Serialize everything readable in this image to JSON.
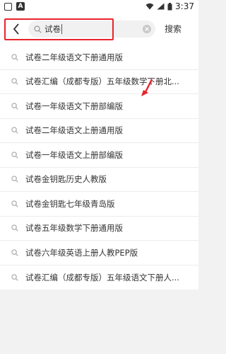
{
  "status_bar": {
    "time": "3:37"
  },
  "search": {
    "query": "试卷",
    "button_label": "搜索"
  },
  "suggestions": [
    "试卷二年级语文下册通用版",
    "试卷汇编（成都专版）五年级数学下册北...",
    "试卷一年级语文下册部编版",
    "试卷二年级语文上册通用版",
    "试卷一年级语文上册部编版",
    "试卷金钥匙历史人教版",
    "试卷金钥匙七年级青岛版",
    "试卷五年级数学下册通用版",
    "试卷六年级英语上册人教PEP版",
    "试卷汇编（成都专版）五年级语文下册人..."
  ],
  "colors": {
    "annotation_red": "#e8242c"
  },
  "icons": {
    "back": "chevron-left-icon",
    "search": "search-icon",
    "clear": "clear-icon"
  }
}
